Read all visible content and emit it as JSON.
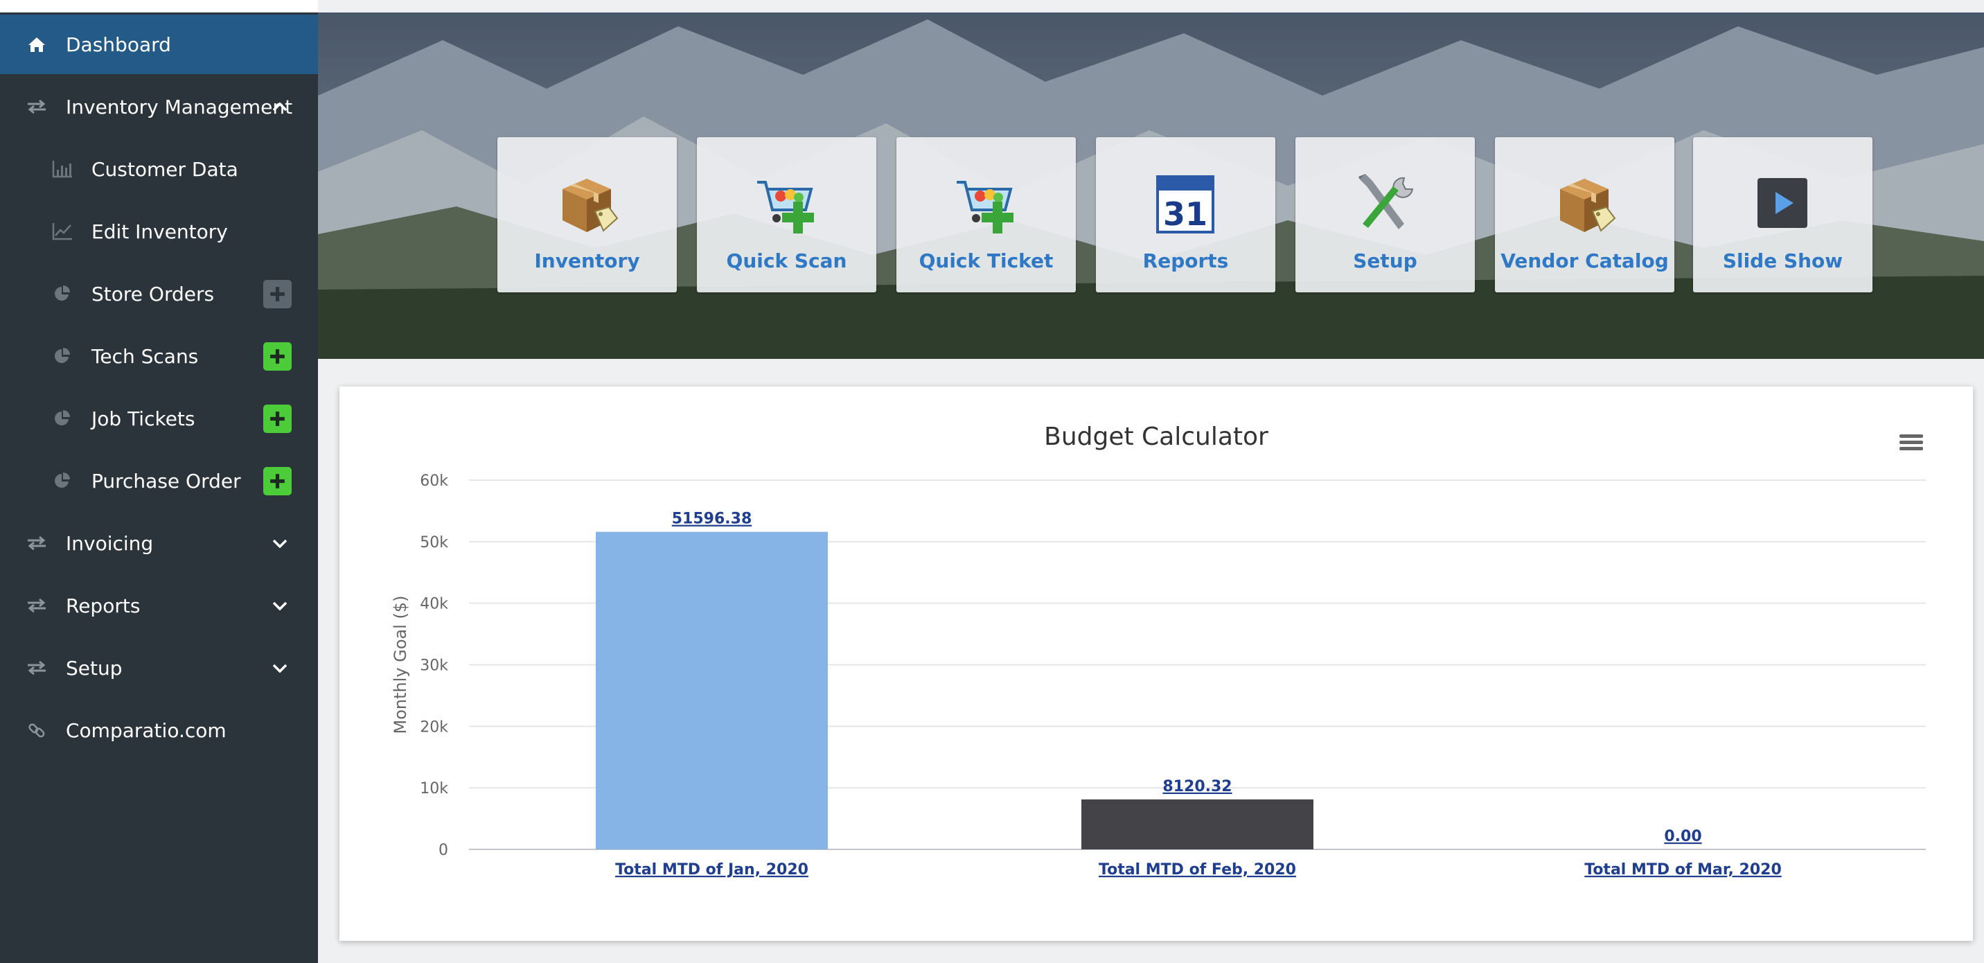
{
  "sidebar": {
    "items": [
      {
        "label": "Dashboard",
        "icon": "home-icon"
      },
      {
        "label": "Inventory Management",
        "icon": "exchange-icon"
      },
      {
        "label": "Customer Data",
        "icon": "bar-chart-icon"
      },
      {
        "label": "Edit Inventory",
        "icon": "line-chart-icon"
      },
      {
        "label": "Store Orders",
        "icon": "pie-chart-icon"
      },
      {
        "label": "Tech Scans",
        "icon": "pie-chart-icon"
      },
      {
        "label": "Job Tickets",
        "icon": "pie-chart-icon"
      },
      {
        "label": "Purchase Order",
        "icon": "pie-chart-icon"
      },
      {
        "label": "Invoicing",
        "icon": "exchange-icon"
      },
      {
        "label": "Reports",
        "icon": "exchange-icon"
      },
      {
        "label": "Setup",
        "icon": "exchange-icon"
      },
      {
        "label": "Comparatio.com",
        "icon": "link-icon"
      }
    ]
  },
  "tiles": [
    {
      "label": "Inventory",
      "icon": "package-icon"
    },
    {
      "label": "Quick Scan",
      "icon": "cart-add-icon"
    },
    {
      "label": "Quick Ticket",
      "icon": "cart-add-icon"
    },
    {
      "label": "Reports",
      "icon": "calendar-icon"
    },
    {
      "label": "Setup",
      "icon": "tools-icon"
    },
    {
      "label": "Vendor Catalog",
      "icon": "package-icon"
    },
    {
      "label": "Slide Show",
      "icon": "play-icon"
    }
  ],
  "colors": {
    "sidebar_bg": "#2c343b",
    "active_bg": "#245a87",
    "tile_label": "#2f78c6",
    "add_green": "#4dcc3a",
    "bar_jan": "#87b4e6",
    "bar_feb": "#434348",
    "link_blue": "#1f3e8f"
  },
  "chart_data": {
    "type": "bar",
    "title": "Budget Calculator",
    "ylabel": "Monthly Goal ($)",
    "xlabel": "",
    "categories": [
      "Total MTD of Jan, 2020",
      "Total MTD of Feb, 2020",
      "Total MTD of Mar, 2020"
    ],
    "values": [
      51596.38,
      8120.32,
      0
    ],
    "data_labels": [
      "51596.38",
      "8120.32",
      "0.00"
    ],
    "ylim": [
      0,
      60000
    ],
    "yticks": [
      0,
      10000,
      20000,
      30000,
      40000,
      50000,
      60000
    ],
    "ytick_labels": [
      "0",
      "10k",
      "20k",
      "30k",
      "40k",
      "50k",
      "60k"
    ],
    "grid": true,
    "legend": "none"
  }
}
